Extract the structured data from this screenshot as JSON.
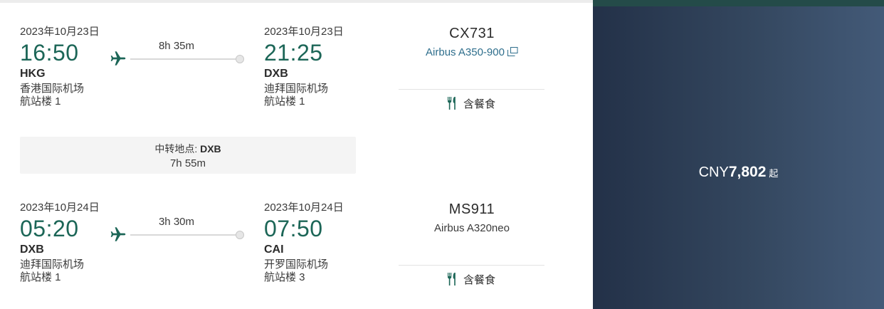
{
  "segments": [
    {
      "departure": {
        "date": "2023年10月23日",
        "time": "16:50",
        "code": "HKG",
        "airport": "香港国际机场",
        "terminal": "航站楼 1"
      },
      "arrival": {
        "date": "2023年10月23日",
        "time": "21:25",
        "code": "DXB",
        "airport": "迪拜国际机场",
        "terminal": "航站楼 1"
      },
      "duration": "8h 35m",
      "flight_number": "CX731",
      "aircraft": "Airbus A350-900",
      "aircraft_is_link": true,
      "meal": "含餐食"
    },
    {
      "departure": {
        "date": "2023年10月24日",
        "time": "05:20",
        "code": "DXB",
        "airport": "迪拜国际机场",
        "terminal": "航站楼 1"
      },
      "arrival": {
        "date": "2023年10月24日",
        "time": "07:50",
        "code": "CAI",
        "airport": "开罗国际机场",
        "terminal": "航站楼 3"
      },
      "duration": "3h 30m",
      "flight_number": "MS911",
      "aircraft": "Airbus A320neo",
      "aircraft_is_link": false,
      "meal": "含餐食"
    }
  ],
  "layover": {
    "label": "中转地点:",
    "airport": "DXB",
    "duration": "7h 55m"
  },
  "price": {
    "currency": "CNY",
    "amount": "7,802",
    "suffix": "起"
  },
  "colors": {
    "time_green": "#1c6657",
    "plane_icon": "#1c6657",
    "link_blue": "#2e6e8c",
    "meal_icon": "#1c6657",
    "panel_dark": "#233148",
    "panel_light": "#435a78",
    "panel_top_stripe": "#244b49"
  },
  "icons": [
    "airplane-icon",
    "external-link-icon",
    "fork-knife-meal-icon"
  ]
}
